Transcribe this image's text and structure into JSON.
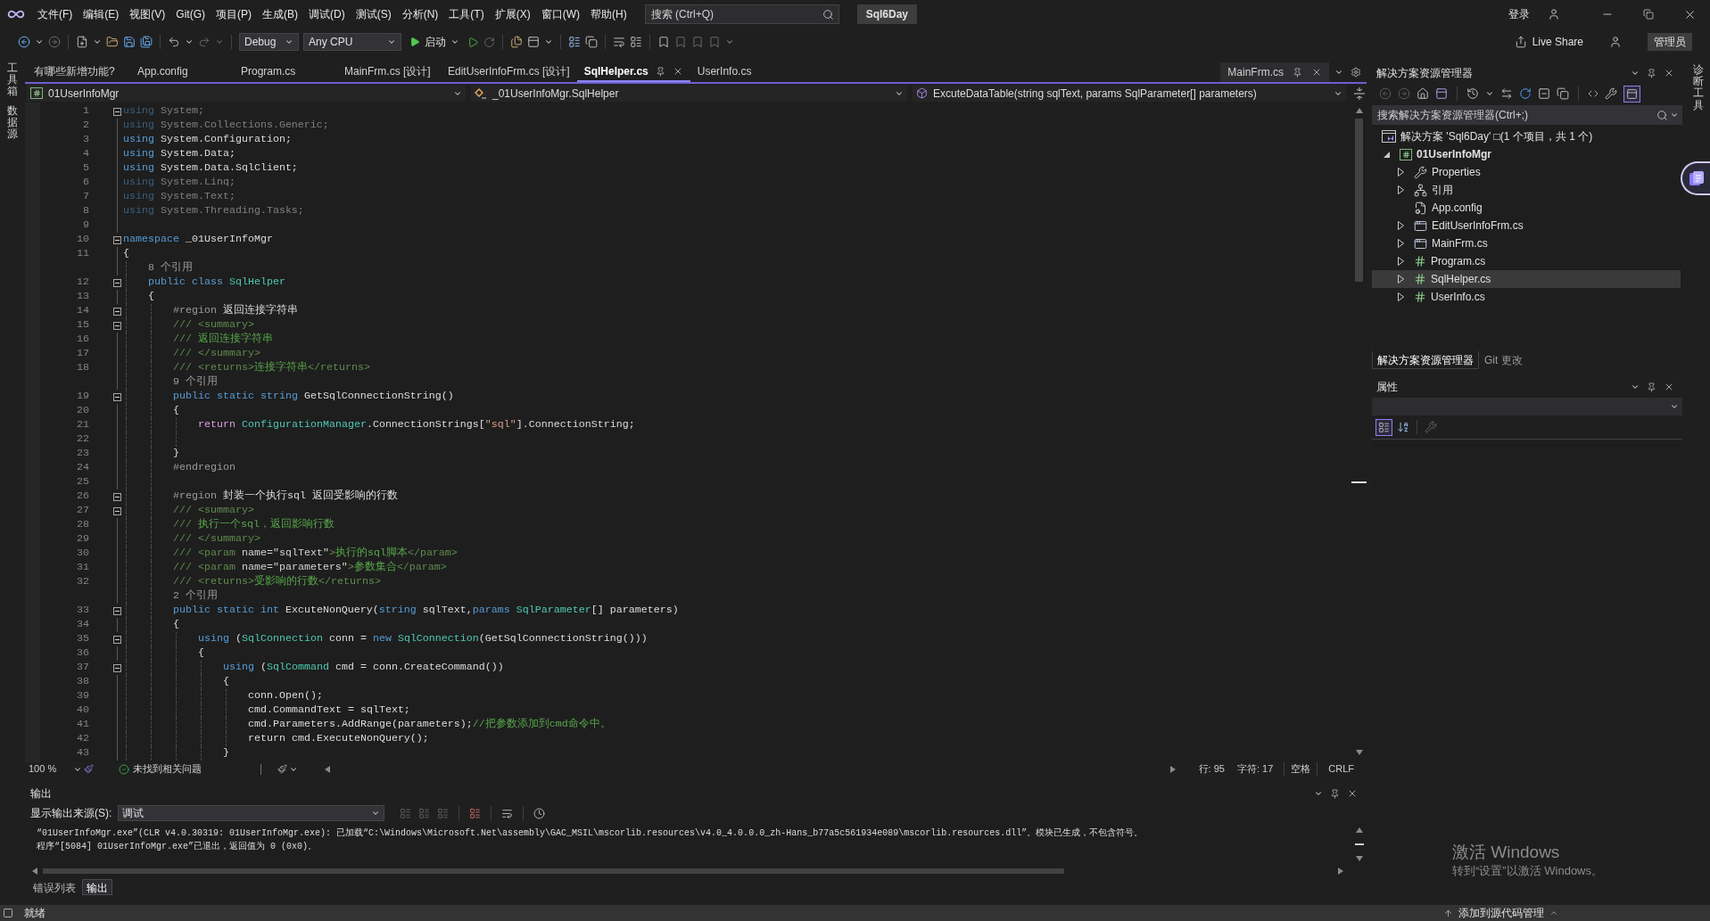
{
  "menu_bar": {
    "menus": [
      "文件(F)",
      "编辑(E)",
      "视图(V)",
      "Git(G)",
      "项目(P)",
      "生成(B)",
      "调试(D)",
      "测试(S)",
      "分析(N)",
      "工具(T)",
      "扩展(X)",
      "窗口(W)",
      "帮助(H)"
    ],
    "search": {
      "placeholder": "搜索 (Ctrl+Q)"
    },
    "solution_name": "Sql6Day",
    "sign_in": "登录"
  },
  "toolbar": {
    "configuration": "Debug",
    "platform": "Any CPU",
    "start": "启动",
    "live_share": "Live Share",
    "admin_badge": "管理员"
  },
  "left_strip": {
    "tabs": [
      "工具箱",
      "数据源"
    ]
  },
  "editor": {
    "tabs": [
      {
        "label": "有哪些新增功能?",
        "selected": false
      },
      {
        "label": "App.config",
        "selected": false
      },
      {
        "label": "Program.cs",
        "selected": false
      },
      {
        "label": "MainFrm.cs [设计]",
        "selected": false
      },
      {
        "label": "EditUserInfoFrm.cs [设计]",
        "selected": false
      },
      {
        "label": "SqlHelper.cs",
        "selected": true
      },
      {
        "label": "UserInfo.cs",
        "selected": false
      }
    ],
    "preview_tab": {
      "label": "MainFrm.cs"
    },
    "navigation": [
      "01UserInfoMgr",
      "_01UserInfoMgr.SqlHelper",
      "ExcuteDataTable(string sqlText, params SqlParameter[] parameters)"
    ],
    "lines": [
      {
        "kind": "code",
        "number": "1",
        "fold": true,
        "faded": true,
        "tokens": [
          {
            "text": "using",
            "kind": "keyword"
          },
          {
            "text": " System;",
            "kind": "plain"
          }
        ]
      },
      {
        "kind": "code",
        "number": "2",
        "fold": false,
        "faded": true,
        "tokens": [
          {
            "text": "using",
            "kind": "keyword"
          },
          {
            "text": " System.Collections.Generic;",
            "kind": "plain"
          }
        ]
      },
      {
        "kind": "code",
        "number": "3",
        "fold": false,
        "faded": false,
        "tokens": [
          {
            "text": "using",
            "kind": "keyword"
          },
          {
            "text": " System.Configuration;",
            "kind": "plain"
          }
        ]
      },
      {
        "kind": "code",
        "number": "4",
        "fold": false,
        "faded": false,
        "tokens": [
          {
            "text": "using",
            "kind": "keyword"
          },
          {
            "text": " System.Data;",
            "kind": "plain"
          }
        ]
      },
      {
        "kind": "code",
        "number": "5",
        "fold": false,
        "faded": false,
        "tokens": [
          {
            "text": "using",
            "kind": "keyword"
          },
          {
            "text": " System.Data.SqlClient;",
            "kind": "plain"
          }
        ]
      },
      {
        "kind": "code",
        "number": "6",
        "fold": false,
        "faded": true,
        "tokens": [
          {
            "text": "using",
            "kind": "keyword"
          },
          {
            "text": " System.Linq;",
            "kind": "plain"
          }
        ]
      },
      {
        "kind": "code",
        "number": "7",
        "fold": false,
        "faded": true,
        "tokens": [
          {
            "text": "using",
            "kind": "keyword"
          },
          {
            "text": " System.Text;",
            "kind": "plain"
          }
        ]
      },
      {
        "kind": "code",
        "number": "8",
        "fold": false,
        "faded": true,
        "tokens": [
          {
            "text": "using",
            "kind": "keyword"
          },
          {
            "text": " System.Threading.Tasks;",
            "kind": "plain"
          }
        ]
      },
      {
        "kind": "code",
        "number": "9",
        "fold": false
      },
      {
        "kind": "code",
        "number": "10",
        "fold": true,
        "faded": false,
        "tokens": [
          {
            "text": "namespace",
            "kind": "keyword"
          },
          {
            "text": " _01UserInfoMgr",
            "kind": "plain"
          }
        ]
      },
      {
        "kind": "code",
        "number": "11",
        "fold": false,
        "faded": false,
        "tokens": [
          {
            "text": "{",
            "kind": "plain"
          }
        ],
        "children": [
          {
            "kind": "codelens",
            "text": "8 个引用"
          },
          {
            "kind": "code",
            "number": "12",
            "fold": true,
            "faded": false,
            "tokens": [
              {
                "text": "public class",
                "kind": "keyword"
              },
              {
                "text": " SqlHelper",
                "kind": "type"
              }
            ]
          },
          {
            "kind": "code",
            "number": "13",
            "fold": false,
            "faded": false,
            "tokens": [
              {
                "text": "{",
                "kind": "plain"
              }
            ],
            "children": [
              {
                "kind": "code",
                "number": "14",
                "fold": true,
                "faded": false,
                "tokens": [
                  {
                    "text": "#region",
                    "kind": "preproc"
                  },
                  {
                    "text": " 返回连接字符串",
                    "kind": "plain"
                  }
                ]
              },
              {
                "kind": "code",
                "number": "15",
                "fold": true,
                "faded": false,
                "tokens": [
                  {
                    "text": "/// <summary>",
                    "kind": "doc"
                  }
                ]
              },
              {
                "kind": "code",
                "number": "16",
                "fold": false,
                "faded": false,
                "tokens": [
                  {
                    "text": "///",
                    "kind": "doc"
                  },
                  {
                    "text": " 返回连接字符串",
                    "kind": "comment"
                  }
                ]
              },
              {
                "kind": "code",
                "number": "17",
                "fold": false,
                "faded": false,
                "tokens": [
                  {
                    "text": "/// </summary>",
                    "kind": "doc"
                  }
                ]
              },
              {
                "kind": "code",
                "number": "18",
                "fold": false,
                "faded": false,
                "tokens": [
                  {
                    "text": "/// <returns>",
                    "kind": "doc"
                  },
                  {
                    "text": "连接字符串",
                    "kind": "comment"
                  },
                  {
                    "text": "</returns>",
                    "kind": "doc"
                  }
                ]
              },
              {
                "kind": "codelens",
                "text": "9 个引用"
              },
              {
                "kind": "code",
                "number": "19",
                "fold": true,
                "faded": false,
                "tokens": [
                  {
                    "text": "public static string",
                    "kind": "keyword"
                  },
                  {
                    "text": " GetSqlConnectionString()",
                    "kind": "plain"
                  }
                ]
              },
              {
                "kind": "code",
                "number": "20",
                "fold": false,
                "faded": false,
                "tokens": [
                  {
                    "text": "{",
                    "kind": "plain"
                  }
                ],
                "children": [
                  {
                    "kind": "code",
                    "number": "21",
                    "fold": false,
                    "faded": false,
                    "tokens": [
                      {
                        "text": "return",
                        "kind": "control"
                      },
                      {
                        "text": " ConfigurationManager",
                        "kind": "type"
                      },
                      {
                        "text": ".ConnectionStrings[",
                        "kind": "plain"
                      },
                      {
                        "text": "\"sql\"",
                        "kind": "string"
                      },
                      {
                        "text": "].ConnectionString;",
                        "kind": "plain"
                      }
                    ]
                  },
                  {
                    "kind": "code",
                    "number": "22",
                    "fold": false
                  }
                ]
              },
              {
                "kind": "code",
                "number": "23",
                "fold": false,
                "faded": false,
                "tokens": [
                  {
                    "text": "}",
                    "kind": "plain"
                  }
                ]
              },
              {
                "kind": "code",
                "number": "24",
                "fold": false,
                "faded": false,
                "tokens": [
                  {
                    "text": "#endregion",
                    "kind": "preproc"
                  }
                ]
              },
              {
                "kind": "code",
                "number": "25",
                "fold": false
              },
              {
                "kind": "code",
                "number": "26",
                "fold": true,
                "faded": false,
                "tokens": [
                  {
                    "text": "#region",
                    "kind": "preproc"
                  },
                  {
                    "text": " 封装一个执行sql 返回受影响的行数",
                    "kind": "plain"
                  }
                ]
              },
              {
                "kind": "code",
                "number": "27",
                "fold": true,
                "faded": false,
                "tokens": [
                  {
                    "text": "/// <summary>",
                    "kind": "doc"
                  }
                ]
              },
              {
                "kind": "code",
                "number": "28",
                "fold": false,
                "faded": false,
                "tokens": [
                  {
                    "text": "///",
                    "kind": "doc"
                  },
                  {
                    "text": " 执行一个sql，返回影响行数",
                    "kind": "comment"
                  }
                ]
              },
              {
                "kind": "code",
                "number": "29",
                "fold": false,
                "faded": false,
                "tokens": [
                  {
                    "text": "/// </summary>",
                    "kind": "doc"
                  }
                ]
              },
              {
                "kind": "code",
                "number": "30",
                "fold": false,
                "faded": false,
                "tokens": [
                  {
                    "text": "/// <param",
                    "kind": "doc"
                  },
                  {
                    "text": " name=\"sqlText\"",
                    "kind": "doc_name"
                  },
                  {
                    "text": ">",
                    "kind": "doc"
                  },
                  {
                    "text": "执行的sql脚本",
                    "kind": "comment"
                  },
                  {
                    "text": "</param>",
                    "kind": "doc"
                  }
                ]
              },
              {
                "kind": "code",
                "number": "31",
                "fold": false,
                "faded": false,
                "tokens": [
                  {
                    "text": "/// <param",
                    "kind": "doc"
                  },
                  {
                    "text": " name=\"parameters\"",
                    "kind": "doc_name"
                  },
                  {
                    "text": ">",
                    "kind": "doc"
                  },
                  {
                    "text": "参数集合",
                    "kind": "comment"
                  },
                  {
                    "text": "</param>",
                    "kind": "doc"
                  }
                ]
              },
              {
                "kind": "code",
                "number": "32",
                "fold": false,
                "faded": false,
                "tokens": [
                  {
                    "text": "/// <returns>",
                    "kind": "doc"
                  },
                  {
                    "text": "受影响的行数",
                    "kind": "comment"
                  },
                  {
                    "text": "</returns>",
                    "kind": "doc"
                  }
                ]
              },
              {
                "kind": "codelens",
                "text": "2 个引用"
              },
              {
                "kind": "code",
                "number": "33",
                "fold": true,
                "faded": false,
                "tokens": [
                  {
                    "text": "public static int",
                    "kind": "keyword"
                  },
                  {
                    "text": " ExcuteNonQuery(",
                    "kind": "plain"
                  },
                  {
                    "text": "string",
                    "kind": "keyword"
                  },
                  {
                    "text": " sqlText,",
                    "kind": "plain"
                  },
                  {
                    "text": "params",
                    "kind": "keyword"
                  },
                  {
                    "text": " SqlParameter",
                    "kind": "type"
                  },
                  {
                    "text": "[] parameters)",
                    "kind": "plain"
                  }
                ]
              },
              {
                "kind": "code",
                "number": "34",
                "fold": false,
                "faded": false,
                "tokens": [
                  {
                    "text": "{",
                    "kind": "plain"
                  }
                ],
                "children": [
                  {
                    "kind": "code",
                    "number": "35",
                    "fold": true,
                    "faded": false,
                    "tokens": [
                      {
                        "text": "using",
                        "kind": "keyword"
                      },
                      {
                        "text": " (",
                        "kind": "plain"
                      },
                      {
                        "text": "SqlConnection",
                        "kind": "type"
                      },
                      {
                        "text": " conn = ",
                        "kind": "plain"
                      },
                      {
                        "text": "new",
                        "kind": "keyword"
                      },
                      {
                        "text": " SqlConnection",
                        "kind": "type"
                      },
                      {
                        "text": "(GetSqlConnectionString()))",
                        "kind": "plain"
                      }
                    ]
                  },
                  {
                    "kind": "code",
                    "number": "36",
                    "fold": false,
                    "faded": false,
                    "tokens": [
                      {
                        "text": "{",
                        "kind": "plain"
                      }
                    ],
                    "children": [
                      {
                        "kind": "code",
                        "number": "37",
                        "fold": true,
                        "faded": false,
                        "tokens": [
                          {
                            "text": "using",
                            "kind": "keyword"
                          },
                          {
                            "text": " (",
                            "kind": "plain"
                          },
                          {
                            "text": "SqlCommand",
                            "kind": "type"
                          },
                          {
                            "text": " cmd = conn.CreateCommand())",
                            "kind": "plain"
                          }
                        ]
                      },
                      {
                        "kind": "code",
                        "number": "38",
                        "fold": false,
                        "faded": false,
                        "tokens": [
                          {
                            "text": "{",
                            "kind": "plain"
                          }
                        ],
                        "children": [
                          {
                            "kind": "code",
                            "number": "39",
                            "fold": false,
                            "faded": false,
                            "tokens": [
                              {
                                "text": "conn.Open();",
                                "kind": "plain"
                              }
                            ]
                          },
                          {
                            "kind": "code",
                            "number": "40",
                            "fold": false,
                            "faded": false,
                            "tokens": [
                              {
                                "text": "cmd.CommandText = sqlText;",
                                "kind": "plain"
                              }
                            ]
                          },
                          {
                            "kind": "code",
                            "number": "41",
                            "fold": false,
                            "faded": false,
                            "tokens": [
                              {
                                "text": "cmd.Parameters.AddRange(parameters);",
                                "kind": "plain"
                              },
                              {
                                "text": "//把参数添加到cmd命令中。",
                                "kind": "comment"
                              }
                            ]
                          },
                          {
                            "kind": "code",
                            "number": "42",
                            "fold": false,
                            "faded": false,
                            "tokens": [
                              {
                                "text": "return cmd.ExecuteNonQuery();",
                                "kind": "plain"
                              }
                            ]
                          }
                        ]
                      },
                      {
                        "kind": "code",
                        "number": "43",
                        "fold": false,
                        "faded": false,
                        "tokens": [
                          {
                            "text": "}",
                            "kind": "plain"
                          }
                        ]
                      }
                    ]
                  }
                ]
              }
            ]
          }
        ]
      }
    ],
    "status": {
      "zoom": "100 %",
      "issues": "未找到相关问题",
      "line": "行: 95",
      "column": "字符: 17",
      "indent_mode": "空格",
      "line_ending": "CRLF"
    }
  },
  "output": {
    "title": "输出",
    "source_label": "显示输出来源(S):",
    "source": "调试",
    "lines": [
      "“01UserInfoMgr.exe”(CLR v4.0.30319: 01UserInfoMgr.exe): 已加载“C:\\Windows\\Microsoft.Net\\assembly\\GAC_MSIL\\mscorlib.resources\\v4.0_4.0.0.0_zh-Hans_b77a5c561934e089\\mscorlib.resources.dll”。模块已生成，不包含符号。",
      "程序“[5084] 01UserInfoMgr.exe”已退出，返回值为 0 (0x0)。"
    ],
    "tabs": [
      {
        "label": "错误列表",
        "selected": false
      },
      {
        "label": "输出",
        "selected": true
      }
    ]
  },
  "solution_explorer": {
    "title": "解决方案资源管理器",
    "toggle_button": {
      "on": true
    },
    "search": {
      "placeholder": "搜索解决方案资源管理器(Ctrl+;)"
    },
    "tree": [
      {
        "label": "解决方案 'Sql6Day' □(1 个项目，共 1 个)",
        "kind": "solution",
        "selected": false,
        "children": [
          {
            "label": "01UserInfoMgr",
            "kind": "project",
            "expanded": true,
            "selected": false,
            "children": [
              {
                "label": "Properties",
                "kind": "properties",
                "expanded": false,
                "selected": false
              },
              {
                "label": "引用",
                "kind": "references",
                "expanded": false,
                "selected": false
              },
              {
                "label": "App.config",
                "kind": "config",
                "selected": false
              },
              {
                "label": "EditUserInfoFrm.cs",
                "kind": "form",
                "expanded": false,
                "selected": false
              },
              {
                "label": "MainFrm.cs",
                "kind": "form",
                "expanded": false,
                "selected": false
              },
              {
                "label": "Program.cs",
                "kind": "csharp",
                "expanded": false,
                "selected": false
              },
              {
                "label": "SqlHelper.cs",
                "kind": "csharp",
                "expanded": false,
                "selected": true
              },
              {
                "label": "UserInfo.cs",
                "kind": "csharp",
                "expanded": false,
                "selected": false
              }
            ]
          }
        ]
      }
    ],
    "tabs": [
      {
        "label": "解决方案资源管理器",
        "selected": true
      },
      {
        "label": "Git 更改",
        "selected": false
      }
    ]
  },
  "properties": {
    "title": "属性",
    "toggle_button": {
      "on": true
    }
  },
  "right_strip": {
    "tabs": [
      "诊断工具"
    ]
  },
  "activation": {
    "title": "激活 Windows",
    "hint": "转到“设置”以激活 Windows。"
  },
  "status_bar": {
    "text": "就绪",
    "source_control": "添加到源代码管理"
  }
}
